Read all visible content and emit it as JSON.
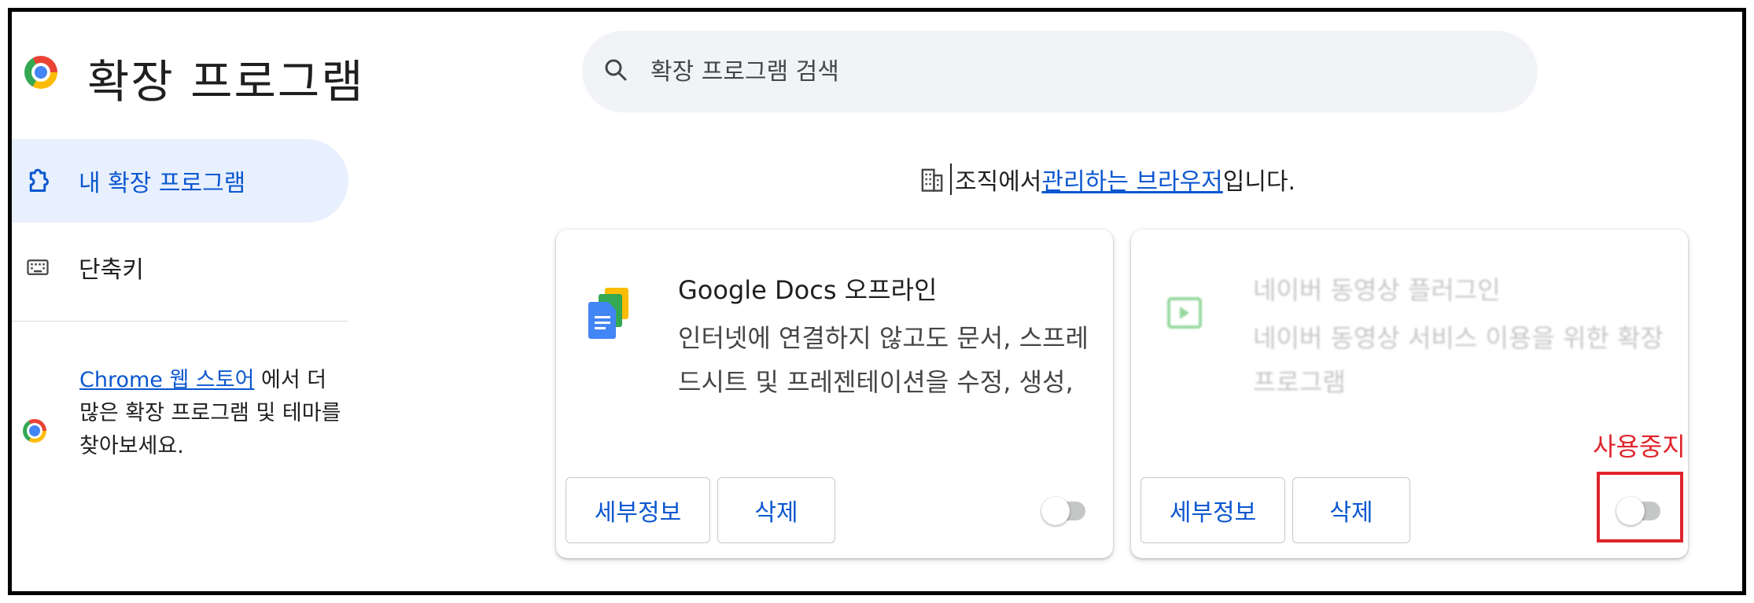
{
  "header": {
    "title": "확장 프로그램",
    "search_placeholder": "확장 프로그램 검색"
  },
  "sidebar": {
    "items": [
      {
        "label": "내 확장 프로그램",
        "icon": "extension-icon",
        "active": true
      },
      {
        "label": "단축키",
        "icon": "keyboard-icon",
        "active": false
      }
    ],
    "store": {
      "link_text": "Chrome 웹 스토어",
      "text": " 에서 더 많은 확장 프로그램 및 테마를 찾아보세요."
    }
  },
  "managed_notice": {
    "prefix": "조직에서 ",
    "link": "관리하는 브라우저",
    "suffix": "입니다."
  },
  "extensions": [
    {
      "name": "Google Docs 오프라인",
      "description": "인터넷에 연결하지 않고도 문서, 스프레드시트 및 프레젠테이션을 수정, 생성,",
      "details_label": "세부정보",
      "remove_label": "삭제",
      "enabled": false
    },
    {
      "name": "네이버 동영상 플러그인",
      "description": "네이버 동영상 서비스 이용을 위한 확장 프로그램",
      "details_label": "세부정보",
      "remove_label": "삭제",
      "enabled": false
    }
  ],
  "annotation": {
    "label": "사용중지",
    "color": "#e0242b"
  },
  "colors": {
    "accent": "#0b57d0",
    "active_nav_bg": "#e8f0fe",
    "search_bg": "#f1f3f6"
  }
}
